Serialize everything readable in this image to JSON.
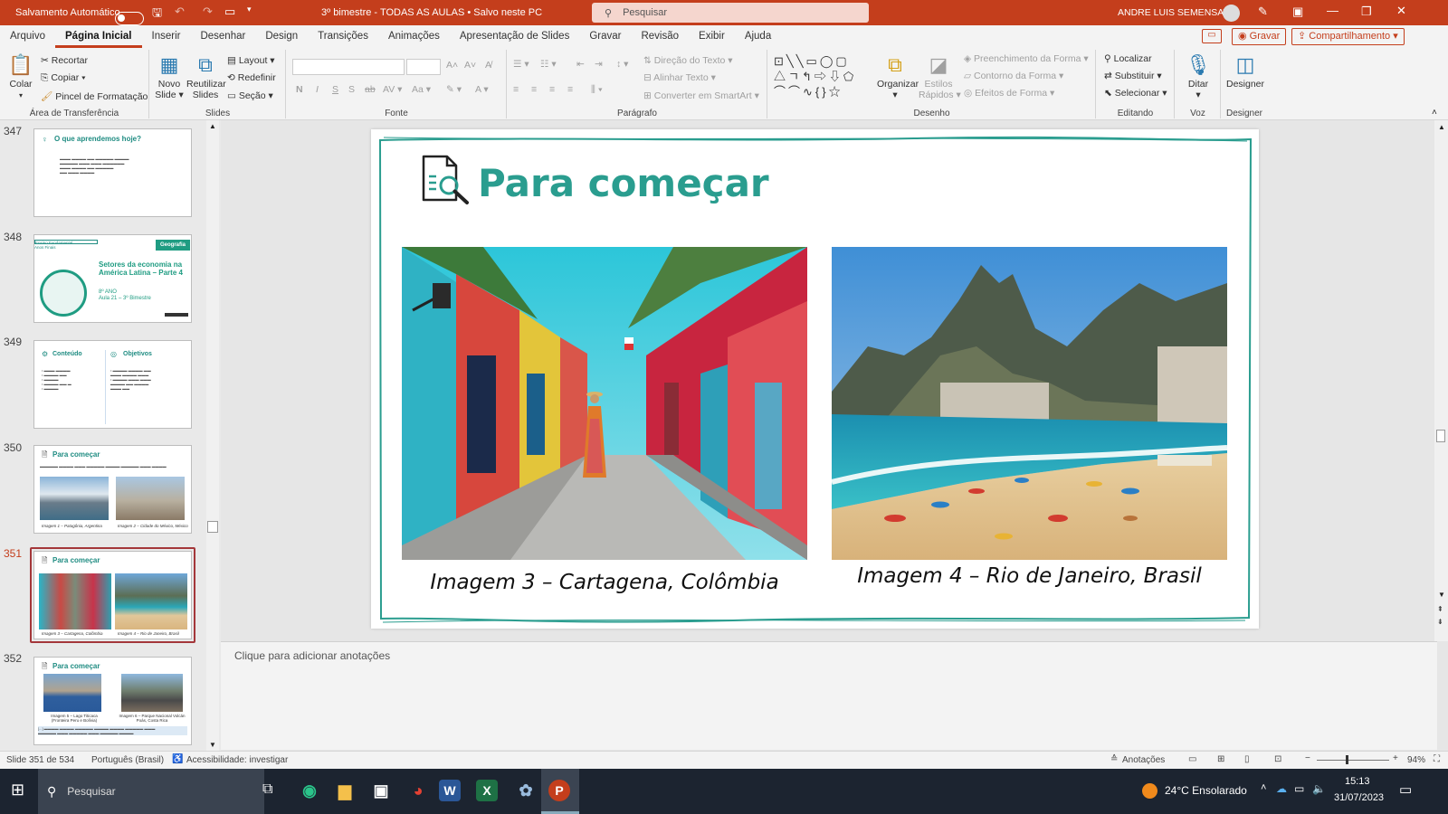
{
  "titlebar": {
    "autosave": "Salvamento Automático",
    "doc_title": "3º bimestre - TODAS AS AULAS • Salvo neste PC",
    "search_placeholder": "Pesquisar",
    "user": "ANDRE LUIS SEMENSATO"
  },
  "menu": {
    "items": [
      "Arquivo",
      "Página Inicial",
      "Inserir",
      "Desenhar",
      "Design",
      "Transições",
      "Animações",
      "Apresentação de Slides",
      "Gravar",
      "Revisão",
      "Exibir",
      "Ajuda"
    ],
    "record": "Gravar",
    "share": "Compartilhamento"
  },
  "ribbon": {
    "clipboard": {
      "paste": "Colar",
      "cut": "Recortar",
      "copy": "Copiar",
      "format_painter": "Pincel de Formatação",
      "label": "Área de Transferência"
    },
    "slides": {
      "new": "Novo",
      "new2": "Slide",
      "reuse": "Reutilizar",
      "reuse2": "Slides",
      "layout": "Layout",
      "reset": "Redefinir",
      "section": "Seção",
      "label": "Slides"
    },
    "font": {
      "label": "Fonte"
    },
    "paragraph": {
      "text_dir": "Direção do Texto",
      "align_text": "Alinhar Texto",
      "smartart": "Converter em SmartArt",
      "label": "Parágrafo"
    },
    "drawing": {
      "arrange": "Organizar",
      "quick_styles": "Estilos",
      "quick_styles2": "Rápidos",
      "fill": "Preenchimento da Forma",
      "outline": "Contorno da Forma",
      "effects": "Efeitos de Forma",
      "label": "Desenho"
    },
    "editing": {
      "find": "Localizar",
      "replace": "Substituir",
      "select": "Selecionar",
      "label": "Editando"
    },
    "voice": {
      "dictate": "Ditar",
      "label": "Voz"
    },
    "designer": {
      "designer": "Designer",
      "label": "Designer"
    }
  },
  "thumbnails": [
    {
      "num": "347",
      "title": "O que aprendemos hoje?"
    },
    {
      "num": "348",
      "title": "Setores da economia na América Latina – Parte 4",
      "badge": "Geografia",
      "grade": "8º ANO",
      "lesson": "Aula 21 – 3º Bimestre",
      "tag1": "Ensino Fundamental",
      "tag2": "Anos Finais"
    },
    {
      "num": "349",
      "col1": "Conteúdo",
      "col2": "Objetivos"
    },
    {
      "num": "350",
      "title": "Para começar",
      "cap1": "Imagem 1 – Patagônia, Argentina",
      "cap2": "Imagem 2 – Cidade do México, México"
    },
    {
      "num": "351",
      "title": "Para começar",
      "cap1": "Imagem 3 – Cartagena, Colômbia",
      "cap2": "Imagem 4 – Rio de Janeiro, Brasil"
    },
    {
      "num": "352",
      "title": "Para começar",
      "cap1": "Imagem 5 – Lago Titicaca (Fronteira Peru e Bolívia)",
      "cap2": "Imagem 6 – Parque Nacional Volcán Poás, Costa Rica"
    }
  ],
  "slide": {
    "title": "Para começar",
    "caption_left": "Imagem 3 – Cartagena, Colômbia",
    "caption_right": "Imagem 4 – Rio de Janeiro, Brasil",
    "accent": "#2a9d8f"
  },
  "notes_placeholder": "Clique para adicionar anotações",
  "status": {
    "slide_count": "Slide 351 de 534",
    "language": "Português (Brasil)",
    "accessibility": "Acessibilidade: investigar",
    "notes": "Anotações",
    "zoom": "94%"
  },
  "taskbar": {
    "search": "Pesquisar",
    "weather": "24°C  Ensolarado",
    "time": "15:13",
    "date": "31/07/2023"
  }
}
